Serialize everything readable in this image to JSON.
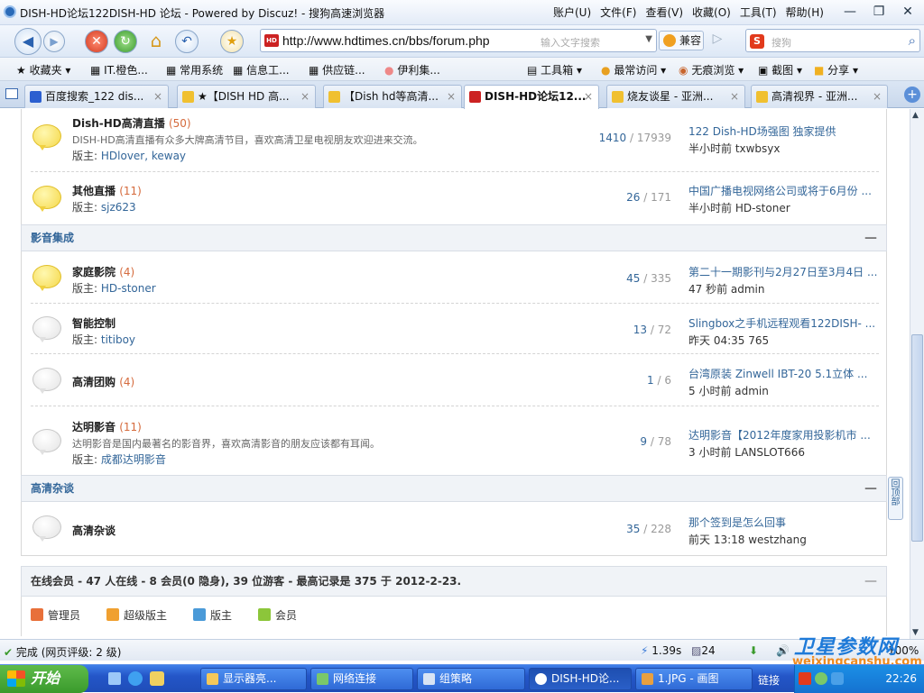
{
  "window": {
    "title": "DISH-HD论坛122DISH-HD 论坛 - Powered by Discuz! - 搜狗高速浏览器"
  },
  "menu": [
    "账户(U)",
    "文件(F)",
    "查看(V)",
    "收藏(O)",
    "工具(T)",
    "帮助(H)"
  ],
  "nav": {
    "url": "http://www.hdtimes.cn/bbs/forum.php",
    "url_hint": "输入文字搜索",
    "compat_label": "兼容",
    "search_placeholder": "搜狗"
  },
  "favorites": [
    "收藏夹",
    "IT.橙色...",
    "常用系统",
    "信息工...",
    "供应链...",
    "伊利集...",
    "工具箱",
    "最常访问",
    "无痕浏览",
    "截图",
    "分享"
  ],
  "tabs": [
    {
      "label": "百度搜索_122 dis..."
    },
    {
      "label": "★【DISH HD 高..."
    },
    {
      "label": "【Dish hd等高清..."
    },
    {
      "label": "DISH-HD论坛12...",
      "active": true
    },
    {
      "label": "烧友谈星 - 亚洲..."
    },
    {
      "label": "高清视界 - 亚洲..."
    }
  ],
  "forum_rows_top": [
    {
      "name": "Dish-HD高清直播",
      "count": "(50)",
      "desc": "DISH-HD高清直播有众多大牌高清节目，喜欢高清卫星电视朋友欢迎进来交流。",
      "mod_label": "版主:",
      "mods": "HDlover, keway",
      "threads": "1410",
      "posts": "17939",
      "last_title": "122 Dish-HD场强图 独家提供",
      "last_when": "半小时前 txwbsyx",
      "new": true
    },
    {
      "name": "其他直播",
      "count": "(11)",
      "desc": "",
      "mod_label": "版主:",
      "mods": "sjz623",
      "threads": "26",
      "posts": "171",
      "last_title": "中国广播电视网络公司或将于6月份 ...",
      "last_when": "半小时前 HD-stoner",
      "new": true
    }
  ],
  "category_video": {
    "title": "影音集成",
    "collapse": "—"
  },
  "forum_rows_video": [
    {
      "name": "家庭影院",
      "count": "(4)",
      "desc": "",
      "mod_label": "版主:",
      "mods": "HD-stoner",
      "threads": "45",
      "posts": "335",
      "last_title": "第二十一期影刊与2月27日至3月4日 ...",
      "last_when": "47 秒前 admin",
      "new": true
    },
    {
      "name": "智能控制",
      "count": "",
      "desc": "",
      "mod_label": "版主:",
      "mods": "titiboy",
      "threads": "13",
      "posts": "72",
      "last_title": "Slingbox之手机远程观看122DISH- ...",
      "last_when": "昨天 04:35 765",
      "new": false
    },
    {
      "name": "高清团购",
      "count": "(4)",
      "desc": "",
      "mod_label": "",
      "mods": "",
      "threads": "1",
      "posts": "6",
      "last_title": "台湾原装 Zinwell IBT-20 5.1立体 ...",
      "last_when": "5 小时前 admin",
      "new": false
    },
    {
      "name": "达明影音",
      "count": "(11)",
      "desc": "达明影音是国内最著名的影音界，喜欢高清影音的朋友应该都有耳闻。",
      "mod_label": "版主:",
      "mods": "成都达明影音",
      "threads": "9",
      "posts": "78",
      "last_title": "达明影音【2012年度家用投影机市 ...",
      "last_when": "3 小时前 LANSLOT666",
      "new": false
    }
  ],
  "category_misc": {
    "title": "高清杂谈",
    "collapse": "—"
  },
  "forum_rows_misc": [
    {
      "name": "高清杂谈",
      "count": "",
      "desc": "",
      "mod_label": "",
      "mods": "",
      "threads": "35",
      "posts": "228",
      "last_title": "那个签到是怎么回事",
      "last_when": "前天 13:18 westzhang",
      "new": false
    }
  ],
  "online": {
    "text": "在线会员 - 47 人在线 - 8 会员(0 隐身), 39 位游客 - 最高记录是 375 于 2012-2-23.",
    "collapse": "—"
  },
  "roles": [
    {
      "label": "管理员",
      "color": "#e8703a"
    },
    {
      "label": "超级版主",
      "color": "#f0a030"
    },
    {
      "label": "版主",
      "color": "#4a9ad8"
    },
    {
      "label": "会员",
      "color": "#8cc63a"
    }
  ],
  "totop_label": "回顶部",
  "status": {
    "done": "完成 (网页评级: 2 级)",
    "speed": "1.39s",
    "count": "24",
    "zoom": "100%"
  },
  "watermark": {
    "line1": "卫星参数网",
    "line2": "weixingcanshu.com"
  },
  "taskbar": {
    "start": "开始",
    "tasks": [
      "显示器亮...",
      "网络连接",
      "组策略",
      "DISH-HD论...",
      "1.JPG - 画图"
    ],
    "links_label": "链接",
    "clock": "22:26"
  },
  "colors": {
    "link": "#336699",
    "count": "#d56a3c",
    "taskbar": "#2456c8"
  }
}
